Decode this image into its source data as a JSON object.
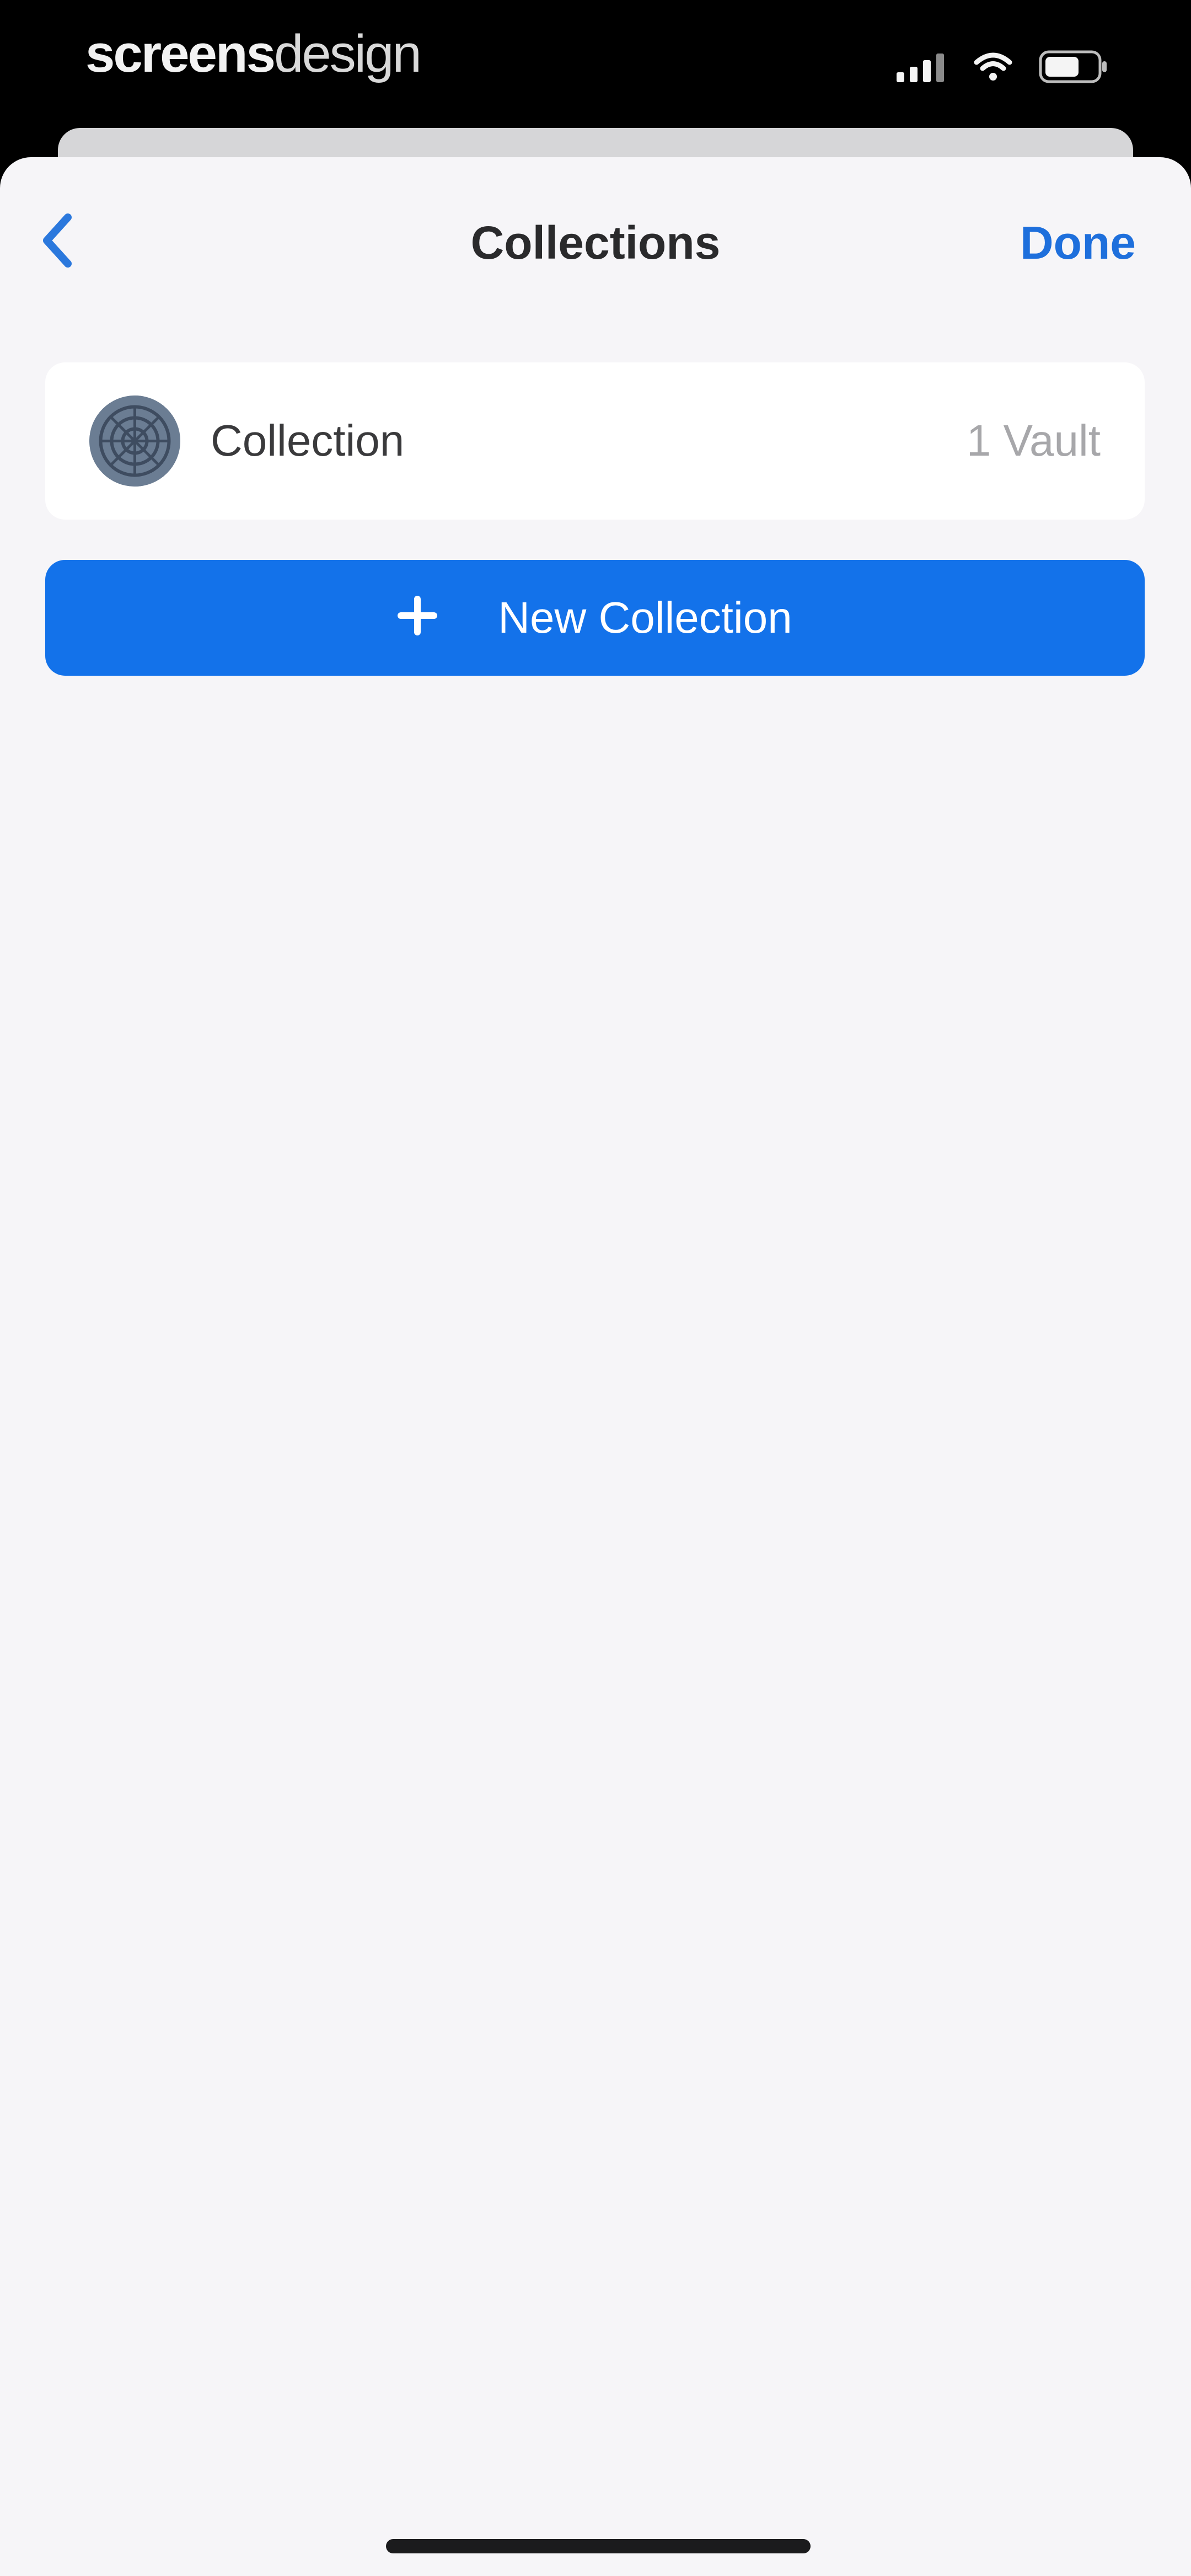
{
  "status_bar": {
    "brand_bold": "screens",
    "brand_light": "design",
    "icons": [
      "signal-icon",
      "wifi-icon",
      "battery-icon"
    ]
  },
  "nav": {
    "back_icon": "chevron-left-icon",
    "title": "Collections",
    "done_label": "Done"
  },
  "collections": [
    {
      "name": "Collection",
      "count": "1 Vault",
      "icon": "collection-avatar"
    }
  ],
  "new_collection": {
    "icon": "plus-icon",
    "label": "New Collection"
  },
  "colors": {
    "accent": "#1e6fdc",
    "button_bg": "#1372ea",
    "sheet_bg": "#f6f5f8"
  }
}
